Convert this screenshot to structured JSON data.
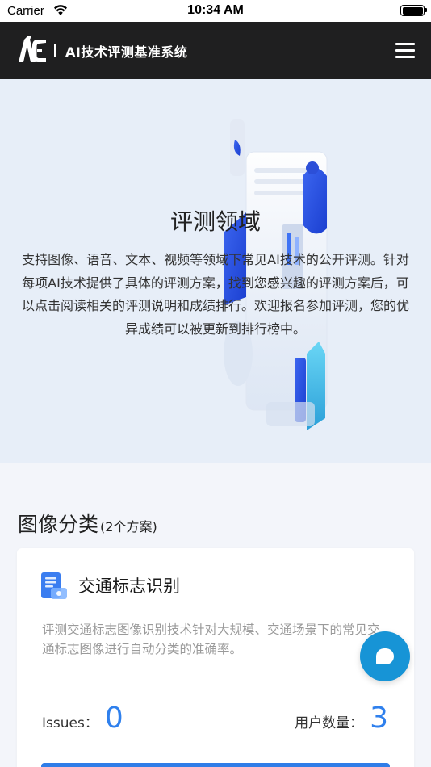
{
  "status_bar": {
    "carrier": "Carrier",
    "time": "10:34 AM"
  },
  "header": {
    "title": "AI技术评测基准系统",
    "menu_icon": "hamburger-menu-icon"
  },
  "hero": {
    "title": "评测领域",
    "description": "支持图像、语音、文本、视频等领域下常见AI技术的公开评测。针对每项AI技术提供了具体的评测方案，找到您感兴趣的评测方案后，可以点击阅读相关的评测说明和成绩排行。欢迎报名参加评测，您的优异成绩可以被更新到排行榜中。"
  },
  "section": {
    "title": "图像分类",
    "count": "(2个方案)"
  },
  "card": {
    "icon": "document-icon",
    "title": "交通标志识别",
    "description": "评测交通标志图像识别技术针对大规模、交通场景下的常见交通标志图像进行自动分类的准确率。",
    "issues_label": "Issues：",
    "issues_value": "0",
    "users_label": "用户数量：",
    "users_value": "3"
  },
  "fab": {
    "icon": "chat-bubble-icon"
  },
  "colors": {
    "accent": "#2f80ed",
    "header_bg": "#1f1f20",
    "hero_bg": "#e7eef8",
    "fab_bg": "#1794d6"
  }
}
